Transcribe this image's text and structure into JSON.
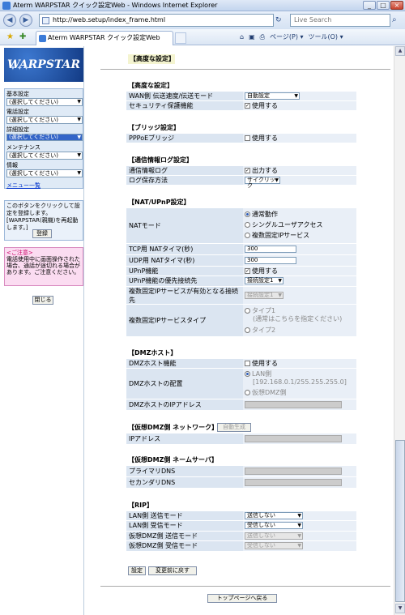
{
  "window": {
    "title": "Aterm WARPSTAR クイック設定Web - Windows Internet Explorer",
    "min": "_",
    "max": "□",
    "close": "×"
  },
  "browser": {
    "back": "◀",
    "forward": "▶",
    "address": "http://web.setup/index_frame.html",
    "search_placeholder": "Live Search",
    "tab_label": "Aterm WARPSTAR クイック設定Web",
    "cmd_page": "ページ(P) ▾",
    "cmd_tools": "ツール(O) ▾"
  },
  "sidebar": {
    "logo": "WARPSTAR",
    "groups": [
      {
        "label": "基本設定",
        "value": "(選択してください)"
      },
      {
        "label": "電話設定",
        "value": "(選択してください)"
      },
      {
        "label": "詳細設定",
        "value": "(選択してください)"
      },
      {
        "label": "メンテナンス",
        "value": "(選択してください)"
      },
      {
        "label": "情報",
        "value": "(選択してください)"
      }
    ],
    "menu_link": "メニュー一覧",
    "notice": "このボタンをクリックして設定を登録します。[WARPSTAR(親機)を再起動します。]",
    "register_button": "登録",
    "caution_title": "<ご注意>",
    "caution_text": "電話使用中に画面操作された場合、通話が途切れる場合があります。ご注意ください。",
    "close_button": "閉じる"
  },
  "main": {
    "page_title": "【高度な設定】",
    "adv": {
      "title": "【高度な設定】",
      "wan_label": "WAN側 伝送速度/伝送モード",
      "wan_value": "自動設定",
      "sec_label": "セキュリティ保護機能",
      "sec_value": "使用する"
    },
    "bridge": {
      "title": "【ブリッジ設定】",
      "pppoe_label": "PPPoEブリッジ",
      "pppoe_value": "使用する"
    },
    "log": {
      "title": "【通信情報ログ設定】",
      "log_label": "通信情報ログ",
      "log_value": "出力する",
      "method_label": "ログ保存方法",
      "method_value": "サイクリック"
    },
    "nat": {
      "title": "【NAT/UPnP設定】",
      "mode_label": "NATモード",
      "mode_opt1": "通常動作",
      "mode_opt2": "シングルユーザアクセス",
      "mode_opt3": "複数固定IPサービス",
      "tcp_label": "TCP用 NATタイマ(秒)",
      "tcp_value": "300",
      "udp_label": "UDP用 NATタイマ(秒)",
      "udp_value": "300",
      "upnp_label": "UPnP機能",
      "upnp_value": "使用する",
      "prio_label": "UPnP機能の優先接続先",
      "prio_value": "接続設定1",
      "multi_label": "複数固定IPサービスが有効となる接続先",
      "multi_value": "接続設定1",
      "type_label": "複数固定IPサービスタイプ",
      "type_opt1": "タイプ1",
      "type_opt1_note": "(通常はこちらを指定ください)",
      "type_opt2": "タイプ2"
    },
    "dmz": {
      "title": "【DMZホスト】",
      "func_label": "DMZホスト機能",
      "func_value": "使用する",
      "place_label": "DMZホストの配置",
      "lan_opt": "LAN側",
      "lan_range": "[192.168.0.1/255.255.255.0]",
      "vdmz_opt": "仮想DMZ側",
      "ip_label": "DMZホストのIPアドレス"
    },
    "vdmz": {
      "title": "【仮想DMZ側 ネットワーク】",
      "auto_button": "自動生成",
      "ip_label": "IPアドレス"
    },
    "vdns": {
      "title": "【仮想DMZ側 ネームサーバ】",
      "primary_label": "プライマリDNS",
      "secondary_label": "セカンダリDNS"
    },
    "rip": {
      "title": "【RIP】",
      "lan_send_label": "LAN側 送信モード",
      "lan_send_value": "送信しない",
      "lan_recv_label": "LAN側 受信モード",
      "lan_recv_value": "受信しない",
      "vdmz_send_label": "仮想DMZ側 送信モード",
      "vdmz_send_value": "送信しない",
      "vdmz_recv_label": "仮想DMZ側 受信モード",
      "vdmz_recv_value": "受信しない"
    },
    "set_button": "設定",
    "revert_button": "変更前に戻す",
    "top_button": "トップページへ戻る"
  }
}
